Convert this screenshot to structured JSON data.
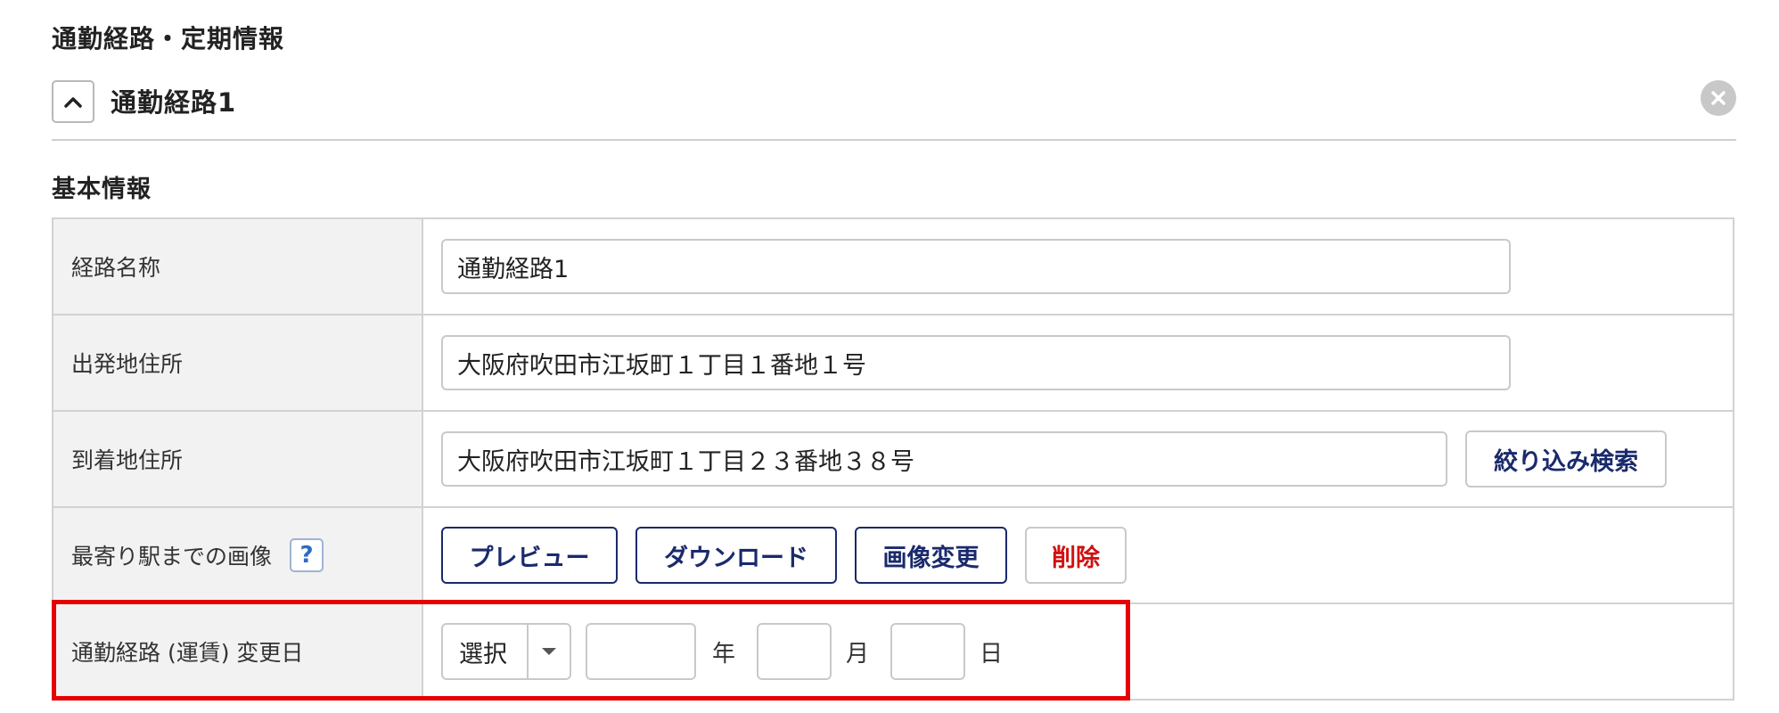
{
  "section_title": "通勤経路・定期情報",
  "route": {
    "title": "通勤経路1",
    "collapse_icon": "chevron-up-icon",
    "close_icon": "close-circle-icon"
  },
  "basic_info": {
    "title": "基本情報",
    "route_name": {
      "label": "経路名称",
      "value": "通勤経路1"
    },
    "departure": {
      "label": "出発地住所",
      "value": "大阪府吹田市江坂町１丁目１番地１号"
    },
    "arrival": {
      "label": "到着地住所",
      "value": "大阪府吹田市江坂町１丁目２３番地３８号",
      "search_label": "絞り込み検索"
    },
    "image": {
      "label": "最寄り駅までの画像",
      "help_text": "?",
      "preview_label": "プレビュー",
      "download_label": "ダウンロード",
      "change_label": "画像変更",
      "delete_label": "削除"
    },
    "change_date": {
      "label": "通勤経路 (運賃) 変更日",
      "era_select": "選択",
      "year_unit": "年",
      "month_unit": "月",
      "day_unit": "日"
    }
  },
  "colors": {
    "highlight": "#e60000",
    "primary": "#1a2a6c",
    "danger": "#d01010",
    "help": "#2d6cc4"
  }
}
